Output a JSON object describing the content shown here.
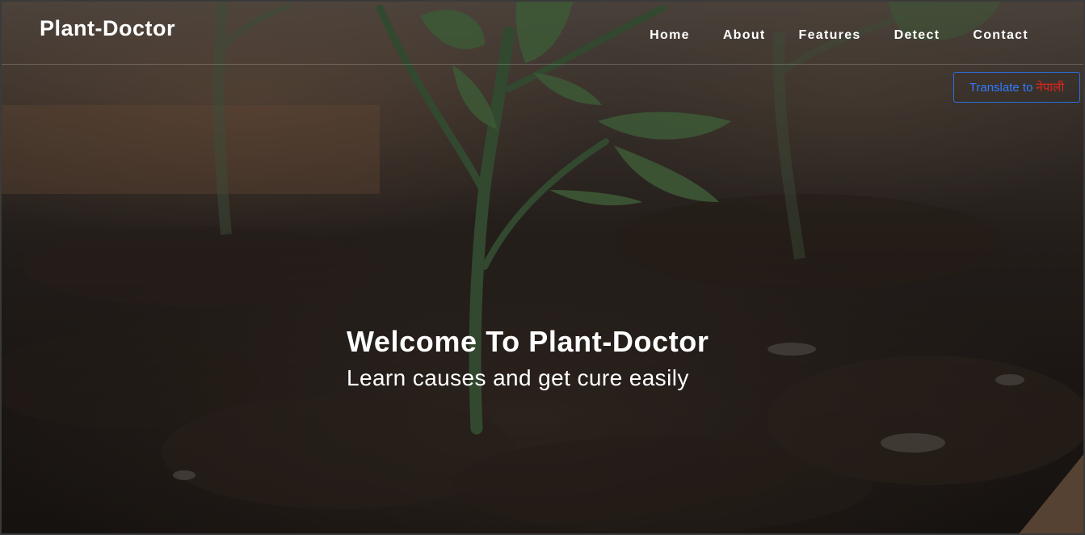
{
  "brand": {
    "name": "Plant-Doctor"
  },
  "nav": {
    "items": [
      {
        "label": "Home"
      },
      {
        "label": "About"
      },
      {
        "label": "Features"
      },
      {
        "label": "Detect"
      },
      {
        "label": "Contact"
      }
    ]
  },
  "translate": {
    "prefix": "Translate to",
    "language": "नेपाली"
  },
  "hero": {
    "title": "Welcome To Plant-Doctor",
    "subtitle": "Learn causes and get cure easily"
  },
  "colors": {
    "nav_text": "#ffffff",
    "translate_border": "#2b6fe0",
    "translate_text": "#2f7bff",
    "translate_language": "#e0261e"
  }
}
